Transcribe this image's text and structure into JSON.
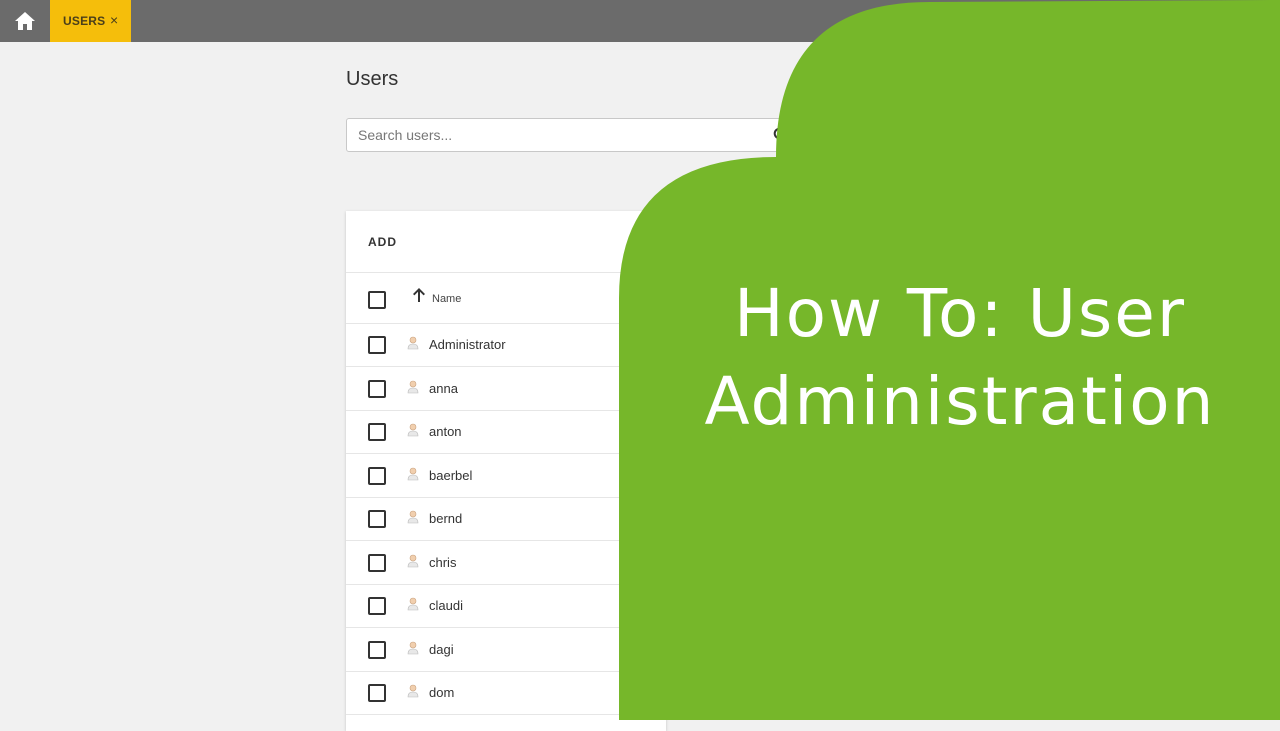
{
  "tabs": [
    {
      "label": "USERS",
      "close": "×"
    }
  ],
  "page": {
    "title": "Users",
    "search_placeholder": "Search users..."
  },
  "list": {
    "add_label": "ADD",
    "column_name": "Name",
    "users": [
      "Administrator",
      "anna",
      "anton",
      "baerbel",
      "bernd",
      "chris",
      "claudi",
      "dagi",
      "dom"
    ]
  },
  "overlay": {
    "line1": "How To: User",
    "line2": "Administration",
    "color": "#76b72a"
  },
  "colors": {
    "topbar": "#6b6b6b",
    "active_tab": "#f5be0b"
  }
}
